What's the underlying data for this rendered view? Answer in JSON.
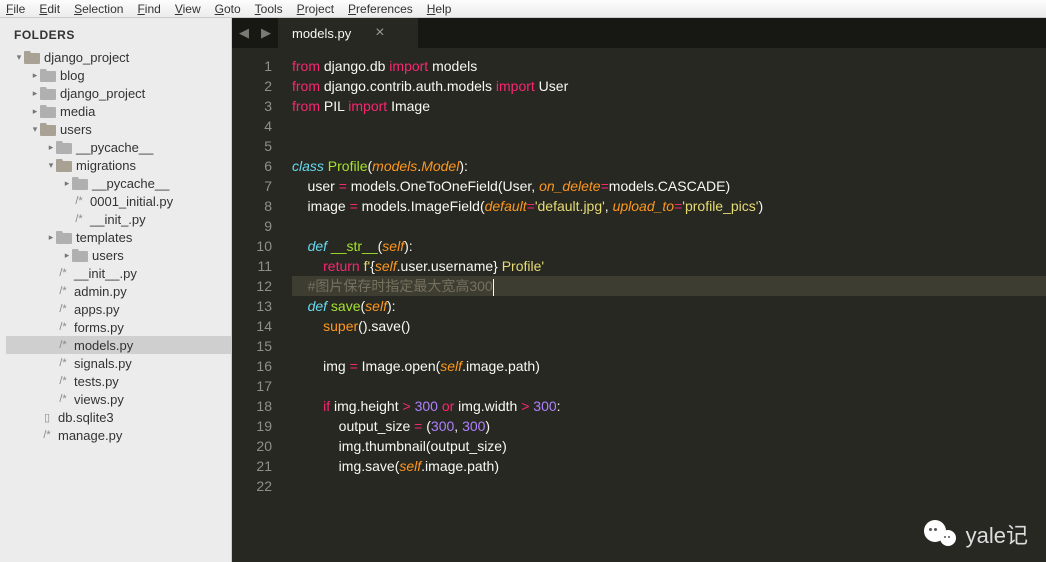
{
  "menu": [
    "File",
    "Edit",
    "Selection",
    "Find",
    "View",
    "Goto",
    "Tools",
    "Project",
    "Preferences",
    "Help"
  ],
  "sidebar": {
    "header": "FOLDERS",
    "rows": [
      {
        "indent": 0,
        "arrow": "▾",
        "type": "folder",
        "open": true,
        "label": "django_project"
      },
      {
        "indent": 1,
        "arrow": "▸",
        "type": "folder",
        "open": false,
        "label": "blog"
      },
      {
        "indent": 1,
        "arrow": "▸",
        "type": "folder",
        "open": false,
        "label": "django_project"
      },
      {
        "indent": 1,
        "arrow": "▸",
        "type": "folder",
        "open": false,
        "label": "media"
      },
      {
        "indent": 1,
        "arrow": "▾",
        "type": "folder",
        "open": true,
        "label": "users"
      },
      {
        "indent": 2,
        "arrow": "▸",
        "type": "folder",
        "open": false,
        "label": "__pycache__"
      },
      {
        "indent": 2,
        "arrow": "▾",
        "type": "folder",
        "open": true,
        "label": "migrations"
      },
      {
        "indent": 3,
        "arrow": "▸",
        "type": "folder",
        "open": false,
        "label": "__pycache__"
      },
      {
        "indent": 3,
        "arrow": "",
        "type": "file",
        "label": "0001_initial.py"
      },
      {
        "indent": 3,
        "arrow": "",
        "type": "file",
        "label": "__init_.py"
      },
      {
        "indent": 2,
        "arrow": "▸",
        "type": "folder",
        "open": false,
        "label": "templates"
      },
      {
        "indent": 3,
        "arrow": "▸",
        "type": "folder",
        "open": false,
        "label": "users"
      },
      {
        "indent": 2,
        "arrow": "",
        "type": "file",
        "label": "__init__.py"
      },
      {
        "indent": 2,
        "arrow": "",
        "type": "file",
        "label": "admin.py"
      },
      {
        "indent": 2,
        "arrow": "",
        "type": "file",
        "label": "apps.py"
      },
      {
        "indent": 2,
        "arrow": "",
        "type": "file",
        "label": "forms.py"
      },
      {
        "indent": 2,
        "arrow": "",
        "type": "file",
        "label": "models.py",
        "selected": true
      },
      {
        "indent": 2,
        "arrow": "",
        "type": "file",
        "label": "signals.py"
      },
      {
        "indent": 2,
        "arrow": "",
        "type": "file",
        "label": "tests.py"
      },
      {
        "indent": 2,
        "arrow": "",
        "type": "file",
        "label": "views.py"
      },
      {
        "indent": 1,
        "arrow": "",
        "type": "dbfile",
        "label": "db.sqlite3"
      },
      {
        "indent": 1,
        "arrow": "",
        "type": "file",
        "label": "manage.py"
      }
    ]
  },
  "tab": {
    "name": "models.py"
  },
  "code": {
    "lines": [
      {
        "n": 1,
        "html": "<span class='kw'>from</span> django.db <span class='kw'>import</span> models"
      },
      {
        "n": 2,
        "html": "<span class='kw'>from</span> django.contrib.auth.models <span class='kw'>import</span> User"
      },
      {
        "n": 3,
        "html": "<span class='kw'>from</span> PIL <span class='kw'>import</span> Image"
      },
      {
        "n": 4,
        "html": ""
      },
      {
        "n": 5,
        "html": ""
      },
      {
        "n": 6,
        "html": "<span class='fn'>class</span> <span class='cls'>Profile</span>(<span class='arg'>models</span>.<span class='arg'>Model</span>):"
      },
      {
        "n": 7,
        "html": "    user <span class='op'>=</span> models.OneToOneField(User, <span class='arg'>on_delete</span><span class='op'>=</span>models.CASCADE)"
      },
      {
        "n": 8,
        "html": "    image <span class='op'>=</span> models.ImageField(<span class='arg'>default</span><span class='op'>=</span><span class='str'>'default.jpg'</span>, <span class='arg'>upload_to</span><span class='op'>=</span><span class='str'>'profile_pics'</span>)"
      },
      {
        "n": 9,
        "html": ""
      },
      {
        "n": 10,
        "html": "    <span class='fn'>def</span> <span class='cls'>__str__</span>(<span class='self'>self</span>):"
      },
      {
        "n": 11,
        "html": "        <span class='kw'>return</span> <span class='str'>f'</span>{<span class='self'>self</span>.user.username}<span class='str'> Profile'</span>"
      },
      {
        "n": 12,
        "hl": true,
        "html": "    <span class='comment'>#图片保存时指定最大宽高300</span><span class='cursor'></span>"
      },
      {
        "n": 13,
        "html": "    <span class='fn'>def</span> <span class='cls'>save</span>(<span class='self'>self</span>):"
      },
      {
        "n": 14,
        "html": "        <span class='builtin'>super</span>().save()"
      },
      {
        "n": 15,
        "html": ""
      },
      {
        "n": 16,
        "html": "        img <span class='op'>=</span> Image.open(<span class='self'>self</span>.image.path)"
      },
      {
        "n": 17,
        "html": ""
      },
      {
        "n": 18,
        "html": "        <span class='kw'>if</span> img.height <span class='op'>&gt;</span> <span class='num'>300</span> <span class='kw'>or</span> img.width <span class='op'>&gt;</span> <span class='num'>300</span>:"
      },
      {
        "n": 19,
        "html": "            output_size <span class='op'>=</span> (<span class='num'>300</span>, <span class='num'>300</span>)"
      },
      {
        "n": 20,
        "html": "            img.thumbnail(output_size)"
      },
      {
        "n": 21,
        "html": "            img.save(<span class='self'>self</span>.image.path)"
      },
      {
        "n": 22,
        "html": ""
      }
    ]
  },
  "watermark": "yale记"
}
